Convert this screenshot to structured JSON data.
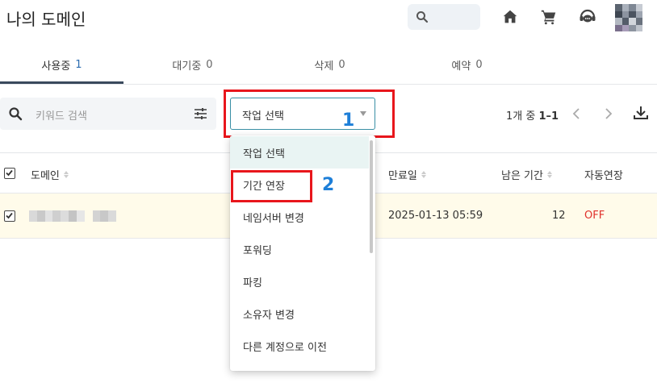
{
  "header": {
    "title": "나의 도메인",
    "icons": [
      "search-icon",
      "home-icon",
      "cart-icon",
      "support-chat-icon",
      "avatar"
    ]
  },
  "tabs": [
    {
      "label": "사용중",
      "count": "1",
      "active": true
    },
    {
      "label": "대기중",
      "count": "0",
      "active": false
    },
    {
      "label": "삭제",
      "count": "0",
      "active": false
    },
    {
      "label": "예약",
      "count": "0",
      "active": false
    }
  ],
  "toolbar": {
    "keyword_placeholder": "키워드 검색",
    "action_select_value": "작업 선택",
    "pagination_prefix": "1개 중 ",
    "pagination_range": "1–1"
  },
  "annotations": {
    "step1": "1",
    "step2": "2"
  },
  "table": {
    "headers": [
      "도메인",
      "만료일",
      "남은 기간",
      "자동연장"
    ],
    "rows": [
      {
        "domain": "",
        "expires": "2025-01-13 05:59",
        "remaining": "12",
        "auto_renew": "OFF"
      }
    ]
  },
  "dropdown": {
    "items": [
      "작업 선택",
      "기간 연장",
      "네임서버 변경",
      "포워딩",
      "파킹",
      "소유자 변경",
      "다른 계정으로 이전"
    ]
  },
  "colors": {
    "accent": "#3a8fa5",
    "annotation_red": "#e8161c",
    "annotation_blue": "#1e7fd8",
    "off_red": "#e0302b",
    "row_highlight": "#fffbea"
  }
}
